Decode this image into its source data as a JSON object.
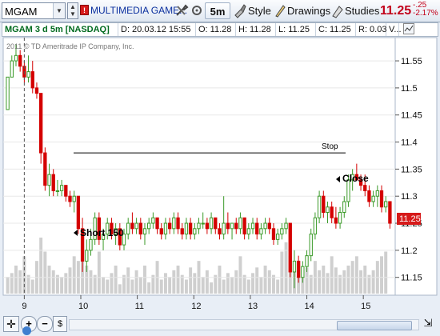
{
  "toolbar": {
    "symbol": "MGAM",
    "flag": "!",
    "description": "MULTIMEDIA GAME...",
    "timeframe": "5m",
    "style_label": "Style",
    "drawings_label": "Drawings",
    "studies_label": "Studies",
    "last_price": "11.25",
    "change": "-.25",
    "change_pct": "-2.17%"
  },
  "info_bar": {
    "title": "MGAM 3 d 5m [NASDAQ]",
    "date": "D: 20.03.12 15:55",
    "open": "O: 11.28",
    "high": "H: 11.28",
    "low": "L: 11.25",
    "close": "C: 11.25",
    "range": "R: 0.03",
    "more": "V..."
  },
  "chart": {
    "copyright": "2011 © TD Ameritrade IP Company, Inc.",
    "annotations": {
      "short": "Short 150",
      "close": "Close",
      "stop": "Stop"
    },
    "current_price_tag": "11.25"
  },
  "colors": {
    "up": "#3a9a28",
    "down": "#d40000",
    "volume": "#cfcfcf",
    "accent_price": "#c2001a",
    "link": "#0a2f9e"
  },
  "chart_data": {
    "type": "candlestick",
    "ylim": [
      11.12,
      11.59
    ],
    "y_ticks": [
      "11.55",
      "11.5",
      "11.45",
      "11.4",
      "11.35",
      "11.3",
      "11.25",
      "11.2",
      "11.15"
    ],
    "x_ticks": [
      "9",
      "10",
      "11",
      "12",
      "13",
      "14",
      "15"
    ],
    "stop_level": 11.38,
    "ohlc": [
      [
        11.46,
        11.52,
        11.46,
        11.52
      ],
      [
        11.52,
        11.56,
        11.52,
        11.55
      ],
      [
        11.55,
        11.58,
        11.54,
        11.56
      ],
      [
        11.56,
        11.57,
        11.53,
        11.54
      ],
      [
        11.54,
        11.55,
        11.51,
        11.52
      ],
      [
        11.52,
        11.56,
        11.51,
        11.53
      ],
      [
        11.53,
        11.55,
        11.49,
        11.5
      ],
      [
        11.5,
        11.51,
        11.48,
        11.49
      ],
      [
        11.49,
        11.49,
        11.36,
        11.38
      ],
      [
        11.38,
        11.39,
        11.31,
        11.32
      ],
      [
        11.32,
        11.36,
        11.3,
        11.34
      ],
      [
        11.34,
        11.35,
        11.3,
        11.31
      ],
      [
        11.31,
        11.33,
        11.3,
        11.31
      ],
      [
        11.31,
        11.33,
        11.3,
        11.32
      ],
      [
        11.32,
        11.32,
        11.29,
        11.3
      ],
      [
        11.3,
        11.31,
        11.28,
        11.29
      ],
      [
        11.29,
        11.31,
        11.27,
        11.3
      ],
      [
        11.3,
        11.3,
        11.23,
        11.24
      ],
      [
        11.24,
        11.26,
        11.16,
        11.18
      ],
      [
        11.18,
        11.22,
        11.16,
        11.2
      ],
      [
        11.2,
        11.24,
        11.19,
        11.22
      ],
      [
        11.22,
        11.27,
        11.21,
        11.26
      ],
      [
        11.26,
        11.27,
        11.21,
        11.22
      ],
      [
        11.22,
        11.24,
        11.2,
        11.23
      ],
      [
        11.23,
        11.26,
        11.22,
        11.25
      ],
      [
        11.25,
        11.26,
        11.22,
        11.23
      ],
      [
        11.23,
        11.25,
        11.21,
        11.24
      ],
      [
        11.24,
        11.25,
        11.2,
        11.21
      ],
      [
        11.21,
        11.24,
        11.2,
        11.23
      ],
      [
        11.23,
        11.26,
        11.22,
        11.25
      ],
      [
        11.25,
        11.27,
        11.23,
        11.24
      ],
      [
        11.24,
        11.26,
        11.23,
        11.25
      ],
      [
        11.25,
        11.26,
        11.22,
        11.23
      ],
      [
        11.23,
        11.25,
        11.21,
        11.24
      ],
      [
        11.24,
        11.26,
        11.23,
        11.25
      ],
      [
        11.25,
        11.27,
        11.24,
        11.26
      ],
      [
        11.26,
        11.26,
        11.23,
        11.24
      ],
      [
        11.24,
        11.25,
        11.22,
        11.23
      ],
      [
        11.23,
        11.26,
        11.22,
        11.25
      ],
      [
        11.25,
        11.26,
        11.23,
        11.24
      ],
      [
        11.24,
        11.27,
        11.23,
        11.26
      ],
      [
        11.26,
        11.27,
        11.23,
        11.24
      ],
      [
        11.24,
        11.25,
        11.22,
        11.23
      ],
      [
        11.23,
        11.26,
        11.22,
        11.25
      ],
      [
        11.25,
        11.26,
        11.22,
        11.23
      ],
      [
        11.23,
        11.25,
        11.22,
        11.24
      ],
      [
        11.24,
        11.26,
        11.23,
        11.25
      ],
      [
        11.25,
        11.27,
        11.24,
        11.25
      ],
      [
        11.25,
        11.26,
        11.23,
        11.24
      ],
      [
        11.24,
        11.27,
        11.23,
        11.26
      ],
      [
        11.26,
        11.26,
        11.23,
        11.24
      ],
      [
        11.24,
        11.25,
        11.22,
        11.23
      ],
      [
        11.23,
        11.3,
        11.22,
        11.25
      ],
      [
        11.25,
        11.27,
        11.23,
        11.24
      ],
      [
        11.24,
        11.25,
        11.22,
        11.25
      ],
      [
        11.25,
        11.26,
        11.23,
        11.24
      ],
      [
        11.24,
        11.27,
        11.23,
        11.26
      ],
      [
        11.26,
        11.26,
        11.22,
        11.23
      ],
      [
        11.23,
        11.25,
        11.22,
        11.24
      ],
      [
        11.24,
        11.26,
        11.23,
        11.25
      ],
      [
        11.25,
        11.26,
        11.22,
        11.23
      ],
      [
        11.23,
        11.25,
        11.22,
        11.24
      ],
      [
        11.24,
        11.26,
        11.23,
        11.25
      ],
      [
        11.25,
        11.26,
        11.23,
        11.24
      ],
      [
        11.24,
        11.25,
        11.21,
        11.22
      ],
      [
        11.22,
        11.24,
        11.21,
        11.23
      ],
      [
        11.23,
        11.25,
        11.22,
        11.24
      ],
      [
        11.24,
        11.26,
        11.23,
        11.25
      ],
      [
        11.25,
        11.25,
        11.15,
        11.16
      ],
      [
        11.16,
        11.2,
        11.13,
        11.18
      ],
      [
        11.18,
        11.19,
        11.14,
        11.15
      ],
      [
        11.15,
        11.18,
        11.14,
        11.17
      ],
      [
        11.17,
        11.2,
        11.16,
        11.19
      ],
      [
        11.19,
        11.24,
        11.18,
        11.23
      ],
      [
        11.23,
        11.27,
        11.22,
        11.26
      ],
      [
        11.26,
        11.31,
        11.25,
        11.3
      ],
      [
        11.3,
        11.31,
        11.26,
        11.27
      ],
      [
        11.27,
        11.29,
        11.25,
        11.28
      ],
      [
        11.28,
        11.29,
        11.25,
        11.26
      ],
      [
        11.26,
        11.28,
        11.24,
        11.25
      ],
      [
        11.25,
        11.28,
        11.24,
        11.27
      ],
      [
        11.27,
        11.3,
        11.26,
        11.29
      ],
      [
        11.29,
        11.34,
        11.28,
        11.33
      ],
      [
        11.33,
        11.35,
        11.31,
        11.34
      ],
      [
        11.34,
        11.36,
        11.33,
        11.33
      ],
      [
        11.33,
        11.34,
        11.31,
        11.32
      ],
      [
        11.32,
        11.34,
        11.3,
        11.31
      ],
      [
        11.31,
        11.32,
        11.28,
        11.29
      ],
      [
        11.29,
        11.31,
        11.28,
        11.3
      ],
      [
        11.3,
        11.32,
        11.28,
        11.31
      ],
      [
        11.31,
        11.32,
        11.27,
        11.28
      ],
      [
        11.28,
        11.3,
        11.27,
        11.29
      ],
      [
        11.29,
        11.29,
        11.24,
        11.25
      ]
    ],
    "volume": [
      18,
      22,
      30,
      25,
      40,
      20,
      15,
      35,
      60,
      45,
      30,
      25,
      20,
      18,
      22,
      28,
      40,
      35,
      50,
      30,
      25,
      20,
      45,
      18,
      15,
      22,
      30,
      10,
      20,
      28,
      15,
      25,
      18,
      30,
      12,
      20,
      35,
      15,
      22,
      18,
      25,
      30,
      20,
      15,
      28,
      22,
      35,
      18,
      25,
      12,
      20,
      30,
      15,
      22,
      18,
      25,
      40,
      20,
      15,
      22,
      28,
      18,
      30,
      25,
      20,
      15,
      45,
      55,
      40,
      35,
      30,
      25,
      28,
      20,
      35,
      25,
      30,
      22,
      40,
      28,
      20,
      25,
      30,
      35,
      40,
      25,
      30,
      20,
      25,
      35,
      40,
      45
    ]
  }
}
